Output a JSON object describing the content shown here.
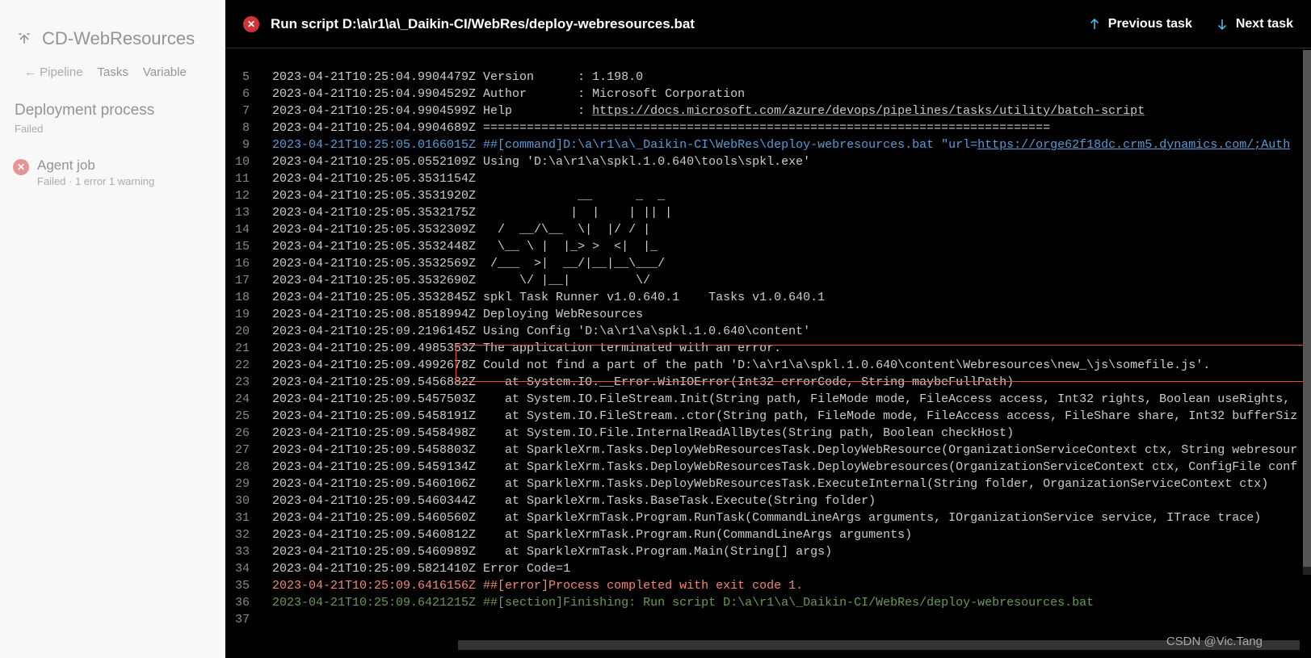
{
  "sidebar": {
    "title": "CD-WebResources",
    "nav": {
      "back": "← Pipeline",
      "tasks": "Tasks",
      "variables": "Variable"
    },
    "deployment": {
      "title": "Deployment process",
      "status": "Failed"
    },
    "agent": {
      "title": "Agent job",
      "sub": "Failed · 1 error 1 warning"
    }
  },
  "header": {
    "title": "Run script D:\\a\\r1\\a\\_Daikin-CI/WebRes/deploy-webresources.bat",
    "prev": "Previous task",
    "next": "Next task"
  },
  "logs": [
    {
      "n": 5,
      "ts": "2023-04-21T10:25:04.9904479Z",
      "t": "Version      : 1.198.0"
    },
    {
      "n": 6,
      "ts": "2023-04-21T10:25:04.9904529Z",
      "t": "Author       : Microsoft Corporation"
    },
    {
      "n": 7,
      "ts": "2023-04-21T10:25:04.9904599Z",
      "t": "Help         : ",
      "link": "https://docs.microsoft.com/azure/devops/pipelines/tasks/utility/batch-script"
    },
    {
      "n": 8,
      "ts": "2023-04-21T10:25:04.9904689Z",
      "t": "=============================================================================="
    },
    {
      "n": 9,
      "ts": "2023-04-21T10:25:05.0166015Z",
      "cls": "cmd",
      "t": "##[command]D:\\a\\r1\\a\\_Daikin-CI\\WebRes\\deploy-webresources.bat \"url=",
      "link": "https://orge62f18dc.crm5.dynamics.com/;Auth"
    },
    {
      "n": 10,
      "ts": "2023-04-21T10:25:05.0552109Z",
      "t": "Using 'D:\\a\\r1\\a\\spkl.1.0.640\\tools\\spkl.exe'"
    },
    {
      "n": 11,
      "ts": "2023-04-21T10:25:05.3531154Z",
      "t": ""
    },
    {
      "n": 12,
      "ts": "2023-04-21T10:25:05.3531920Z",
      "t": "             __      _  _ "
    },
    {
      "n": 13,
      "ts": "2023-04-21T10:25:05.3532175Z",
      "t": "            |  |    | || |"
    },
    {
      "n": 14,
      "ts": "2023-04-21T10:25:05.3532309Z",
      "t": "  /  __/\\__  \\|  |/ / |"
    },
    {
      "n": 15,
      "ts": "2023-04-21T10:25:05.3532448Z",
      "t": "  \\__ \\ |  |_> >  <|  |_"
    },
    {
      "n": 16,
      "ts": "2023-04-21T10:25:05.3532569Z",
      "t": " /___  >|  __/|__|__\\___/"
    },
    {
      "n": 17,
      "ts": "2023-04-21T10:25:05.3532690Z",
      "t": "     \\/ |__|         \\/  "
    },
    {
      "n": 18,
      "ts": "2023-04-21T10:25:05.3532845Z",
      "t": "spkl Task Runner v1.0.640.1    Tasks v1.0.640.1"
    },
    {
      "n": 19,
      "ts": "2023-04-21T10:25:08.8518994Z",
      "t": "Deploying WebResources"
    },
    {
      "n": 20,
      "ts": "2023-04-21T10:25:09.2196145Z",
      "t": "Using Config 'D:\\a\\r1\\a\\spkl.1.0.640\\content'"
    },
    {
      "n": 21,
      "ts": "2023-04-21T10:25:09.4985353Z",
      "t": "The application terminated with an error."
    },
    {
      "n": 22,
      "ts": "2023-04-21T10:25:09.4992678Z",
      "t": "Could not find a part of the path 'D:\\a\\r1\\a\\spkl.1.0.640\\content\\Webresources\\new_\\js\\somefile.js'."
    },
    {
      "n": 23,
      "ts": "2023-04-21T10:25:09.5456882Z",
      "t": "   at System.IO.__Error.WinIOError(Int32 errorCode, String maybeFullPath)"
    },
    {
      "n": 24,
      "ts": "2023-04-21T10:25:09.5457503Z",
      "t": "   at System.IO.FileStream.Init(String path, FileMode mode, FileAccess access, Int32 rights, Boolean useRights, "
    },
    {
      "n": 25,
      "ts": "2023-04-21T10:25:09.5458191Z",
      "t": "   at System.IO.FileStream..ctor(String path, FileMode mode, FileAccess access, FileShare share, Int32 bufferSiz"
    },
    {
      "n": 26,
      "ts": "2023-04-21T10:25:09.5458498Z",
      "t": "   at System.IO.File.InternalReadAllBytes(String path, Boolean checkHost)"
    },
    {
      "n": 27,
      "ts": "2023-04-21T10:25:09.5458803Z",
      "t": "   at SparkleXrm.Tasks.DeployWebResourcesTask.DeployWebResource(OrganizationServiceContext ctx, String webresour"
    },
    {
      "n": 28,
      "ts": "2023-04-21T10:25:09.5459134Z",
      "t": "   at SparkleXrm.Tasks.DeployWebResourcesTask.DeployWebresources(OrganizationServiceContext ctx, ConfigFile conf"
    },
    {
      "n": 29,
      "ts": "2023-04-21T10:25:09.5460106Z",
      "t": "   at SparkleXrm.Tasks.DeployWebResourcesTask.ExecuteInternal(String folder, OrganizationServiceContext ctx)"
    },
    {
      "n": 30,
      "ts": "2023-04-21T10:25:09.5460344Z",
      "t": "   at SparkleXrm.Tasks.BaseTask.Execute(String folder)"
    },
    {
      "n": 31,
      "ts": "2023-04-21T10:25:09.5460560Z",
      "t": "   at SparkleXrmTask.Program.RunTask(CommandLineArgs arguments, IOrganizationService service, ITrace trace)"
    },
    {
      "n": 32,
      "ts": "2023-04-21T10:25:09.5460812Z",
      "t": "   at SparkleXrmTask.Program.Run(CommandLineArgs arguments)"
    },
    {
      "n": 33,
      "ts": "2023-04-21T10:25:09.5460989Z",
      "t": "   at SparkleXrmTask.Program.Main(String[] args)"
    },
    {
      "n": 34,
      "ts": "2023-04-21T10:25:09.5821410Z",
      "t": "Error Code=1"
    },
    {
      "n": 35,
      "ts": "2023-04-21T10:25:09.6416156Z",
      "cls": "err",
      "t": "##[error]Process completed with exit code 1."
    },
    {
      "n": 36,
      "ts": "2023-04-21T10:25:09.6421215Z",
      "cls": "sec",
      "t": "##[section]Finishing: Run script D:\\a\\r1\\a\\_Daikin-CI/WebRes/deploy-webresources.bat"
    },
    {
      "n": 37,
      "ts": "",
      "t": ""
    }
  ],
  "watermark": "CSDN @Vic.Tang"
}
